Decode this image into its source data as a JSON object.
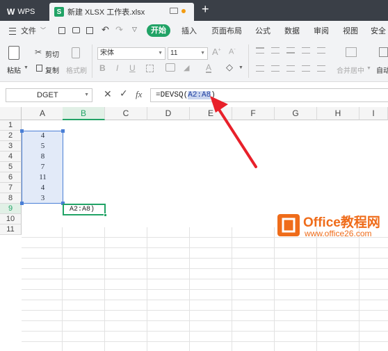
{
  "titlebar": {
    "app_tab": "WPS",
    "doc_tab": "新建 XLSX 工作表.xlsx",
    "new_tab": "+"
  },
  "menubar": {
    "file": "文件",
    "start": "开始",
    "items": [
      "插入",
      "页面布局",
      "公式",
      "数据",
      "审阅",
      "视图",
      "安全"
    ]
  },
  "ribbon": {
    "cut": "剪切",
    "paste": "粘贴",
    "copy": "复制",
    "format_painter": "格式刷",
    "font_name": "宋体",
    "font_size": "11",
    "merge_center": "合并居中",
    "auto_wrap": "自动"
  },
  "formula_bar": {
    "name_box": "DGET",
    "fx": "fx",
    "formula_prefix": "=DEVSQ(",
    "formula_ref": "A2:A8",
    "formula_suffix": ")"
  },
  "grid": {
    "columns": [
      "A",
      "B",
      "C",
      "D",
      "E",
      "F",
      "G",
      "H",
      "I"
    ],
    "rows": [
      "1",
      "2",
      "3",
      "4",
      "5",
      "6",
      "7",
      "8",
      "9",
      "10",
      "11"
    ],
    "column_a_values": [
      "",
      "4",
      "5",
      "8",
      "7",
      "11",
      "4",
      "3",
      "",
      "",
      ""
    ],
    "b9_edit_text": "A2:A8)",
    "selected_column": "B",
    "selected_row": "9"
  },
  "watermark": {
    "brand": "Office教程网",
    "url": "www.office26.com"
  },
  "colors": {
    "title_bar": "#3a3f47",
    "accent_green": "#21a366",
    "selection_blue": "#4a7fd6",
    "arrow_red": "#e8202a",
    "watermark_orange": "#ef6c1a"
  }
}
